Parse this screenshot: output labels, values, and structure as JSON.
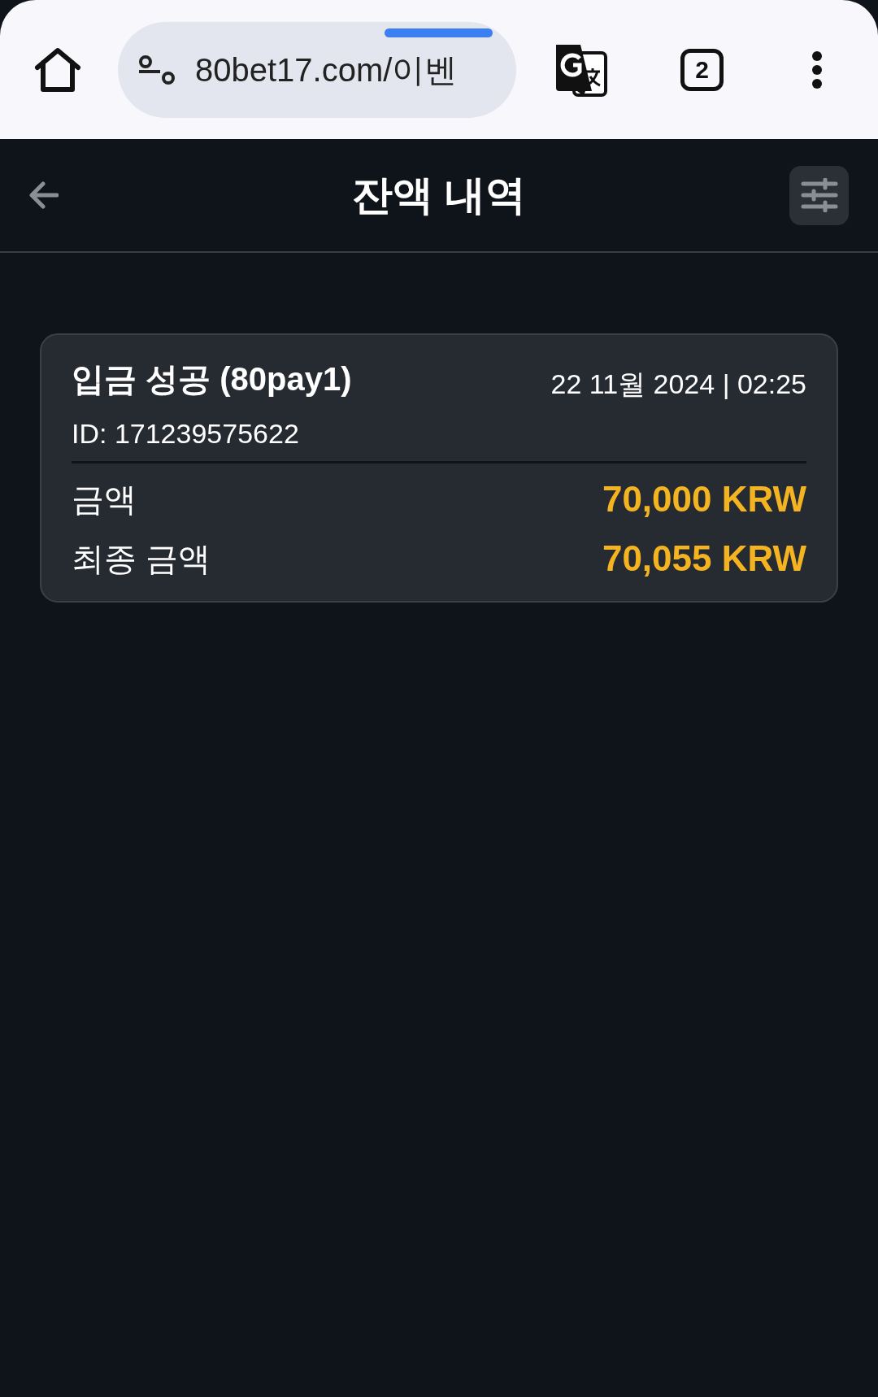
{
  "browser": {
    "url": "80bet17.com/이벤",
    "tab_count": "2"
  },
  "header": {
    "title": "잔액 내역"
  },
  "transactions": [
    {
      "title": "입금 성공 (80pay1)",
      "datetime": "22 11월 2024 | 02:25",
      "id": "ID: 171239575622",
      "amounts": [
        {
          "label": "금액",
          "value": "70,000 KRW"
        },
        {
          "label": "최종 금액",
          "value": "70,055 KRW"
        }
      ]
    }
  ]
}
